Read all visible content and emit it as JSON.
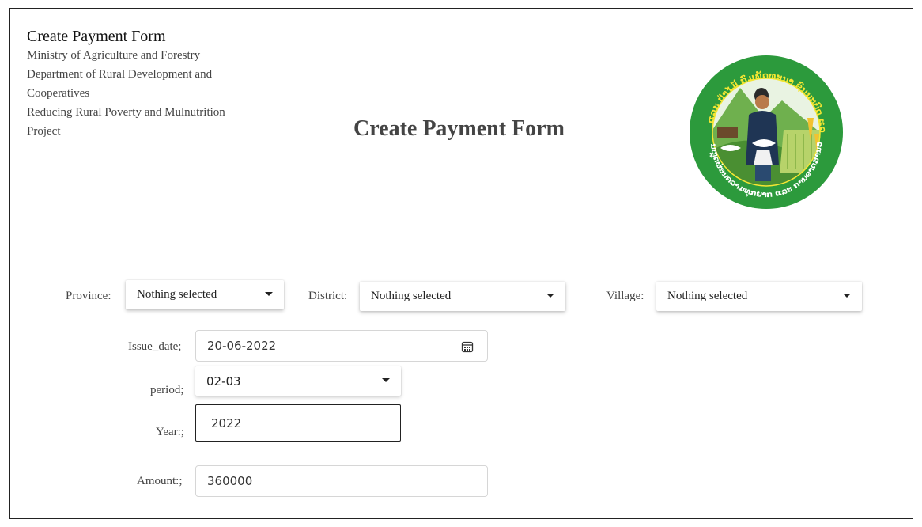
{
  "header": {
    "app_title": "Create Payment Form",
    "org_lines": [
      "Ministry of Agriculture and Forestry",
      "Department of Rural Development and",
      "Cooperatives",
      "Reducing Rural Poverty and Mulnutrition",
      "Project"
    ],
    "page_title": "Create Payment Form"
  },
  "logo": {
    "icon": "project-seal-logo",
    "colors": {
      "ring": "#2c9a3c",
      "inner": "#e9f3e2",
      "text": "#f5e633"
    },
    "text_top": "ກະຊວງກະສິກຳ ແລະ ປ່າໄມ້ ກົມພັດທະນາ ຊົນນະບົດ ແລະ ສະຫະກອນ",
    "text_bottom": "ໂຄງການຫຼຸດຜ່ອນຄວາມທຸກຍາກ ແລະ ການຂາດສານອາຫານ"
  },
  "location": {
    "province": {
      "label": "Province:",
      "value": "Nothing selected"
    },
    "district": {
      "label": "District:",
      "value": "Nothing selected"
    },
    "village": {
      "label": "Village:",
      "value": "Nothing selected"
    }
  },
  "form": {
    "issue_date": {
      "label": "Issue_date;",
      "value": "20-06-2022",
      "icon": "calendar-icon"
    },
    "period": {
      "label": "period;",
      "value": "02-03"
    },
    "year": {
      "label": "Year:;",
      "value": "2022"
    },
    "amount": {
      "label": "Amount:;",
      "value": "360000"
    }
  }
}
